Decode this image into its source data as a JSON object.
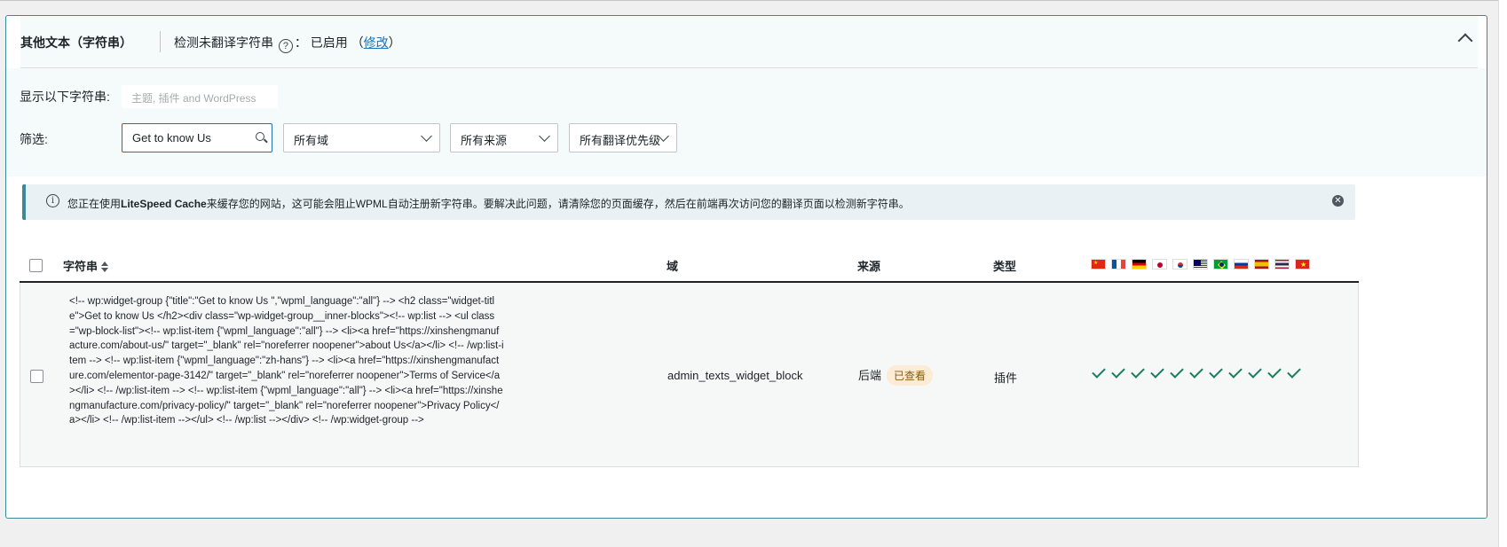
{
  "section": {
    "title": "其他文本（字符串）",
    "detect_label": "检测未翻译字符串",
    "detect_colon": "：",
    "detect_status": "已启用",
    "modify_open": "（",
    "modify_link": "修改",
    "modify_close": "）"
  },
  "filters": {
    "show_label": "显示以下字符串:",
    "show_placeholder": "主题, 插件 and WordPress",
    "filter_label": "筛选:",
    "search_value": "Get to know Us",
    "domain_select": "所有域",
    "source_select": "所有来源",
    "priority_select": "所有翻译优先级"
  },
  "notice": {
    "before": "您正在使用",
    "bold": "LiteSpeed Cache",
    "after": "来缓存您的网站，这可能会阻止WPML自动注册新字符串。要解决此问题，请清除您的页面缓存，然后在前端再次访问您的翻译页面以检测新字符串。",
    "close_glyph": "✕"
  },
  "table": {
    "columns": {
      "string": "字符串",
      "domain": "域",
      "source": "来源",
      "type": "类型"
    },
    "flags": [
      "flag-cn",
      "flag-fr",
      "flag-de",
      "flag-jp",
      "flag-kr",
      "flag-my",
      "flag-br",
      "flag-ru",
      "flag-es",
      "flag-th",
      "flag-vn"
    ],
    "rows": [
      {
        "string": "<!-- wp:widget-group {\"title\":\"Get to know Us \",\"wpml_language\":\"all\"} --> <h2 class=\"widget-title\">Get to know Us </h2><div class=\"wp-widget-group__inner-blocks\"><!-- wp:list --> <ul class=\"wp-block-list\"><!-- wp:list-item {\"wpml_language\":\"all\"} --> <li><a href=\"https://xinshengmanufacture.com/about-us/\" target=\"_blank\" rel=\"noreferrer noopener\">about Us</a></li> <!-- /wp:list-item --> <!-- wp:list-item {\"wpml_language\":\"zh-hans\"} --> <li><a href=\"https://xinshengmanufacture.com/elementor-page-3142/\" target=\"_blank\" rel=\"noreferrer noopener\">Terms of Service</a></li> <!-- /wp:list-item --> <!-- wp:list-item {\"wpml_language\":\"all\"} --> <li><a href=\"https://xinshengmanufacture.com/privacy-policy/\" target=\"_blank\" rel=\"noreferrer noopener\">Privacy Policy</a></li> <!-- /wp:list-item --></ul> <!-- /wp:list --></div> <!-- /wp:widget-group -->",
        "domain": "admin_texts_widget_block",
        "source": "后端",
        "source_badge": "已查看",
        "type": "插件",
        "translation_status": [
          "translated",
          "translated",
          "translated",
          "translated",
          "translated",
          "translated",
          "translated",
          "translated",
          "translated",
          "translated",
          "translated"
        ]
      }
    ]
  },
  "colors": {
    "accent": "#3a8a9a",
    "link": "#2271b1",
    "check": "#1a7c5e",
    "badge_bg": "#fcebd5"
  }
}
